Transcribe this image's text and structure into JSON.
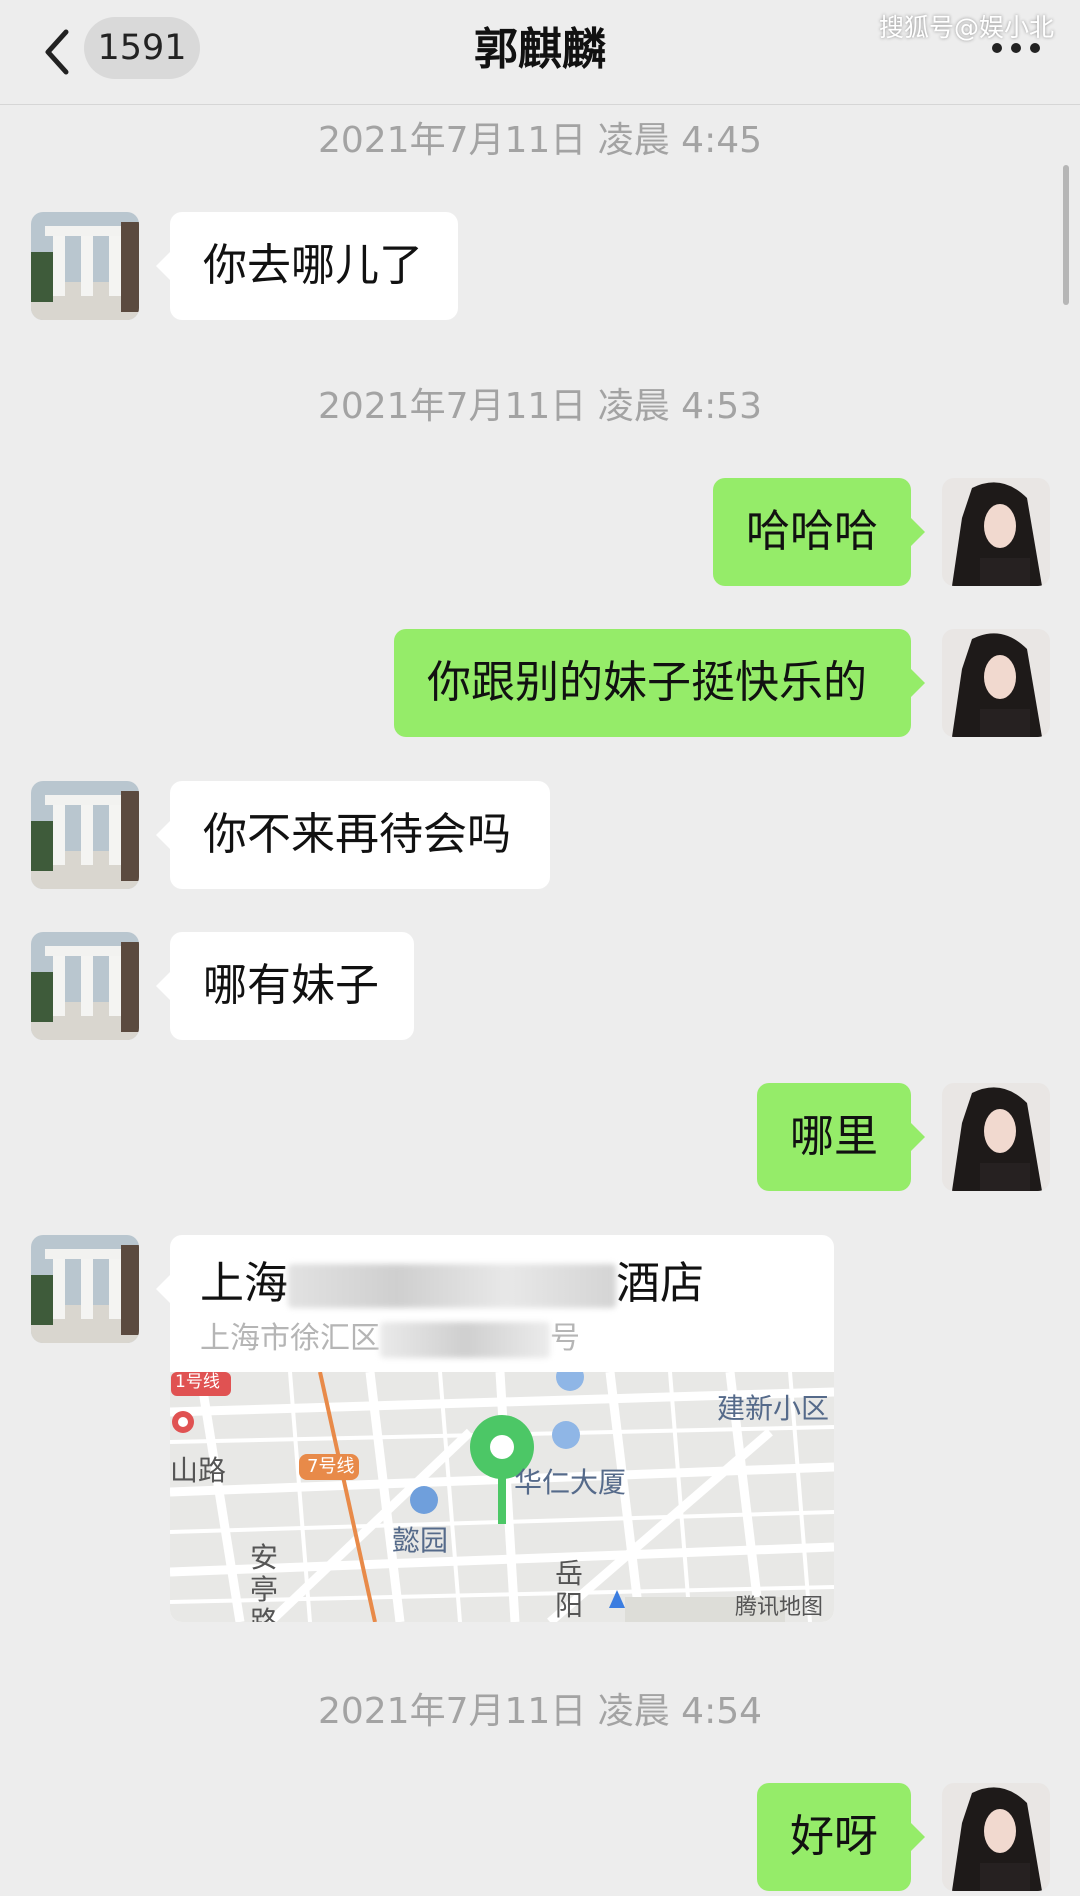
{
  "header": {
    "badge": "1591",
    "title": "郭麒麟",
    "watermark": "搜狐号@娱小北"
  },
  "messages": {
    "t1": "2021年7月11日 凌晨 4:45",
    "m1": "你去哪儿了",
    "t2": "2021年7月11日 凌晨 4:53",
    "m2": "哈哈哈",
    "m3": "你跟别的妹子挺快乐的",
    "m4": "你不来再待会吗",
    "m5": "哪有妹子",
    "m6": "哪里",
    "t3": "2021年7月11日 凌晨 4:54",
    "m7": "好呀"
  },
  "location": {
    "title_start": "上海",
    "title_end": "酒店",
    "address_start": "上海市徐汇区",
    "address_end": "号",
    "map_labels": {
      "metro_1": "1号线",
      "metro_7": "7号线",
      "road_shan": "山路",
      "district": "建新小区",
      "building": "华仁大厦",
      "garden": "懿园",
      "road_anting": "安亭路",
      "road_yueyang": "岳阳路",
      "provider": "腾讯地图"
    }
  },
  "colors": {
    "background": "#ededed",
    "incoming_bubble": "#ffffff",
    "outgoing_bubble": "#95ec69",
    "timestamp": "#a3a3a3",
    "pin": "#4cc766"
  }
}
